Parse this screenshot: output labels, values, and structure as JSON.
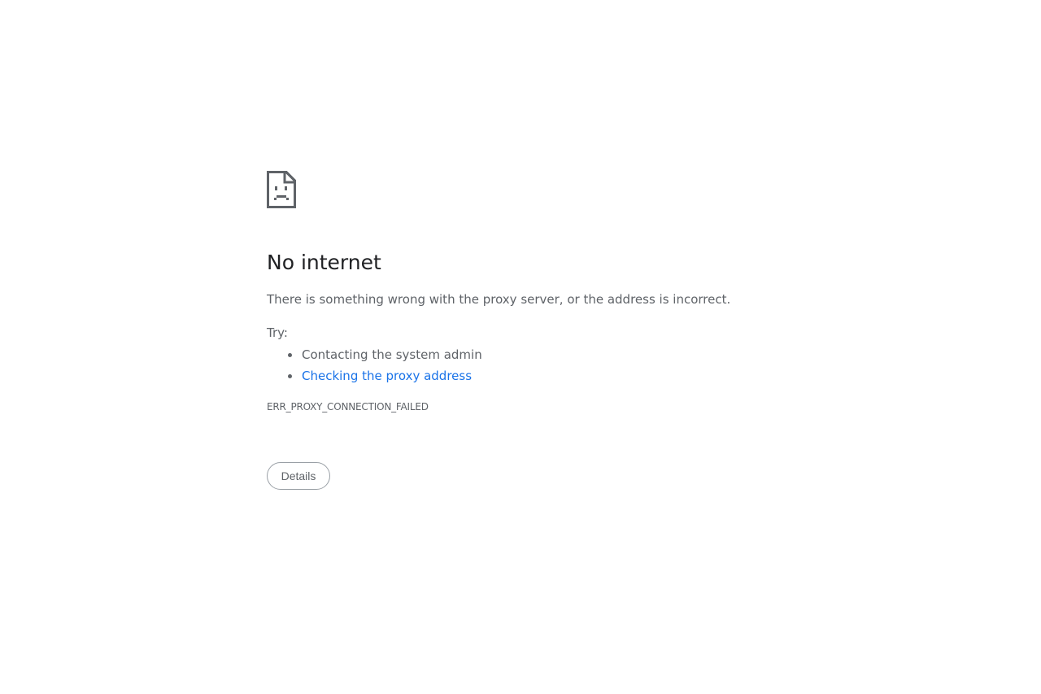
{
  "error": {
    "icon": "sad-page-icon",
    "title": "No internet",
    "summary": "There is something wrong with the proxy server, or the address is incorrect.",
    "try_label": "Try:",
    "suggestions": [
      {
        "text": "Contacting the system admin",
        "link": false
      },
      {
        "text": "Checking the proxy address",
        "link": true
      }
    ],
    "code": "ERR_PROXY_CONNECTION_FAILED",
    "details_button": "Details"
  },
  "colors": {
    "heading": "#202124",
    "body_text": "#5f6368",
    "link": "#1a73e8",
    "button_border": "#9aa0a6",
    "background": "#ffffff"
  }
}
